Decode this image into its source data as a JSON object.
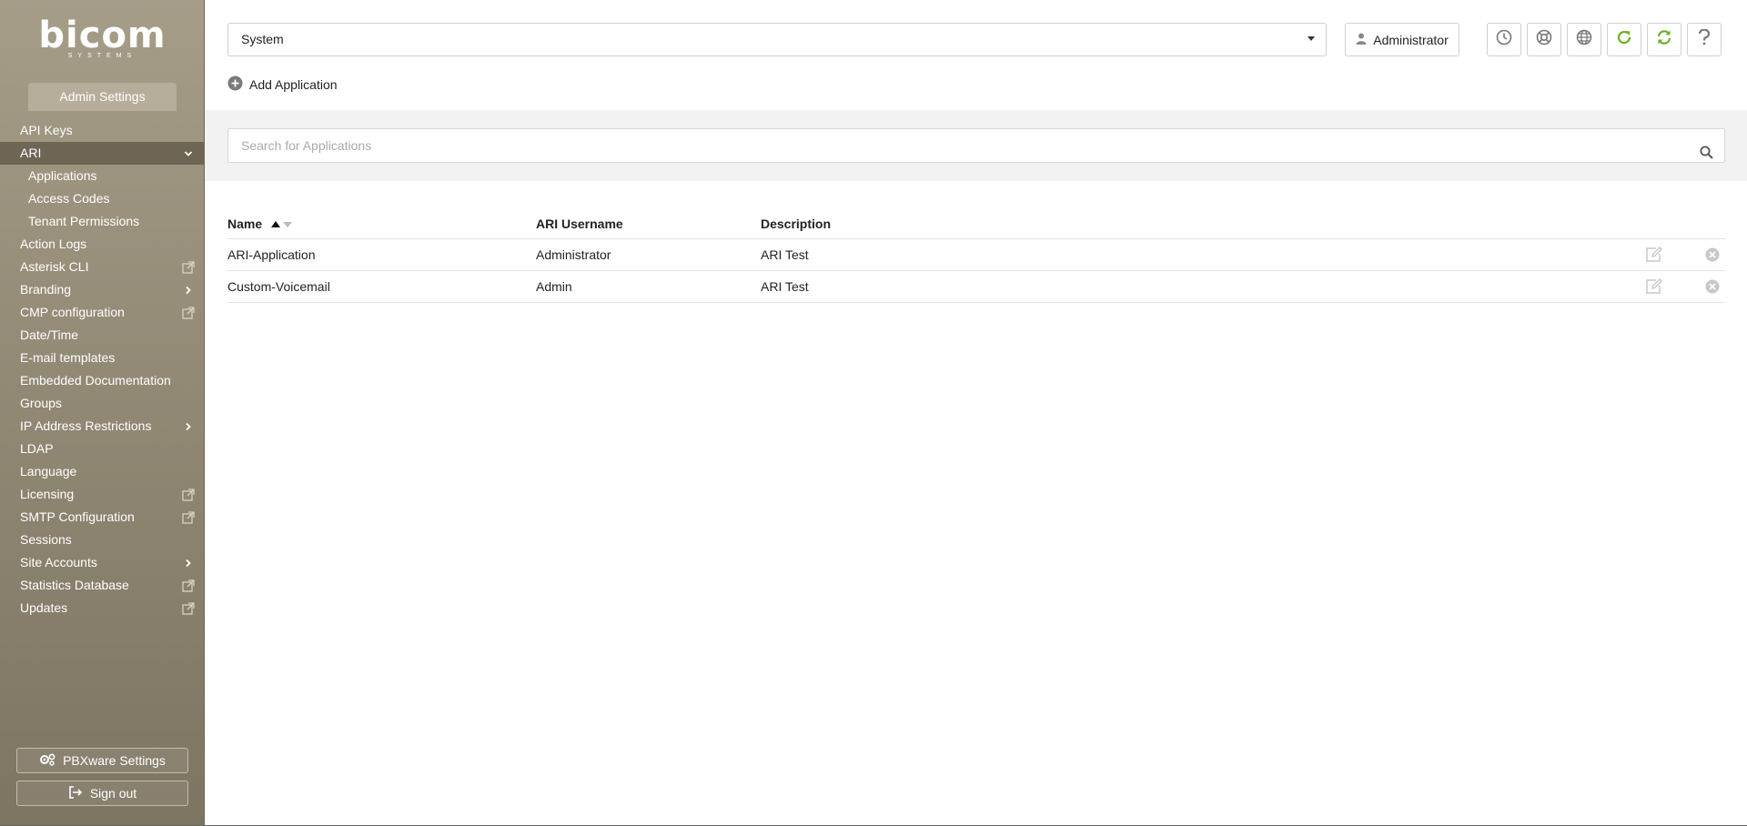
{
  "sidebar": {
    "logo": {
      "brand": "bicom",
      "sub": "SYSTEMS"
    },
    "tab_label": "Admin Settings",
    "items": [
      {
        "label": "API Keys",
        "icon": ""
      },
      {
        "label": "ARI",
        "icon": "chevron-down-icon",
        "active": true
      },
      {
        "label": "Applications",
        "sub": true
      },
      {
        "label": "Access Codes",
        "sub": true
      },
      {
        "label": "Tenant Permissions",
        "sub": true
      },
      {
        "label": "Action Logs",
        "icon": ""
      },
      {
        "label": "Asterisk CLI",
        "icon": "external-link-icon"
      },
      {
        "label": "Branding",
        "icon": "chevron-right-icon"
      },
      {
        "label": "CMP configuration",
        "icon": "external-link-icon"
      },
      {
        "label": "Date/Time",
        "icon": ""
      },
      {
        "label": "E-mail templates",
        "icon": ""
      },
      {
        "label": "Embedded Documentation",
        "icon": ""
      },
      {
        "label": "Groups",
        "icon": ""
      },
      {
        "label": "IP Address Restrictions",
        "icon": "chevron-right-icon"
      },
      {
        "label": "LDAP",
        "icon": ""
      },
      {
        "label": "Language",
        "icon": ""
      },
      {
        "label": "Licensing",
        "icon": "external-link-icon"
      },
      {
        "label": "SMTP Configuration",
        "icon": "external-link-icon"
      },
      {
        "label": "Sessions",
        "icon": ""
      },
      {
        "label": "Site Accounts",
        "icon": "chevron-right-icon"
      },
      {
        "label": "Statistics Database",
        "icon": "external-link-icon"
      },
      {
        "label": "Updates",
        "icon": "external-link-icon"
      }
    ],
    "pbxware_settings_label": "PBXware Settings",
    "sign_out_label": "Sign out"
  },
  "header": {
    "system_select_value": "System",
    "user_button_label": "Administrator",
    "tools": [
      "clock-icon",
      "support-icon",
      "globe-icon",
      "reload-icon",
      "sync-icon",
      "help-icon"
    ]
  },
  "main": {
    "add_application_label": "Add Application",
    "search_placeholder": "Search for Applications",
    "table": {
      "columns": [
        "Name",
        "ARI Username",
        "Description"
      ],
      "rows": [
        {
          "name": "ARI-Application",
          "user": "Administrator",
          "description": "ARI Test"
        },
        {
          "name": "Custom-Voicemail",
          "user": "Admin",
          "description": "ARI Test"
        }
      ]
    }
  },
  "colors": {
    "sidebar": "#928a75",
    "accent_green": "#6ab023"
  }
}
